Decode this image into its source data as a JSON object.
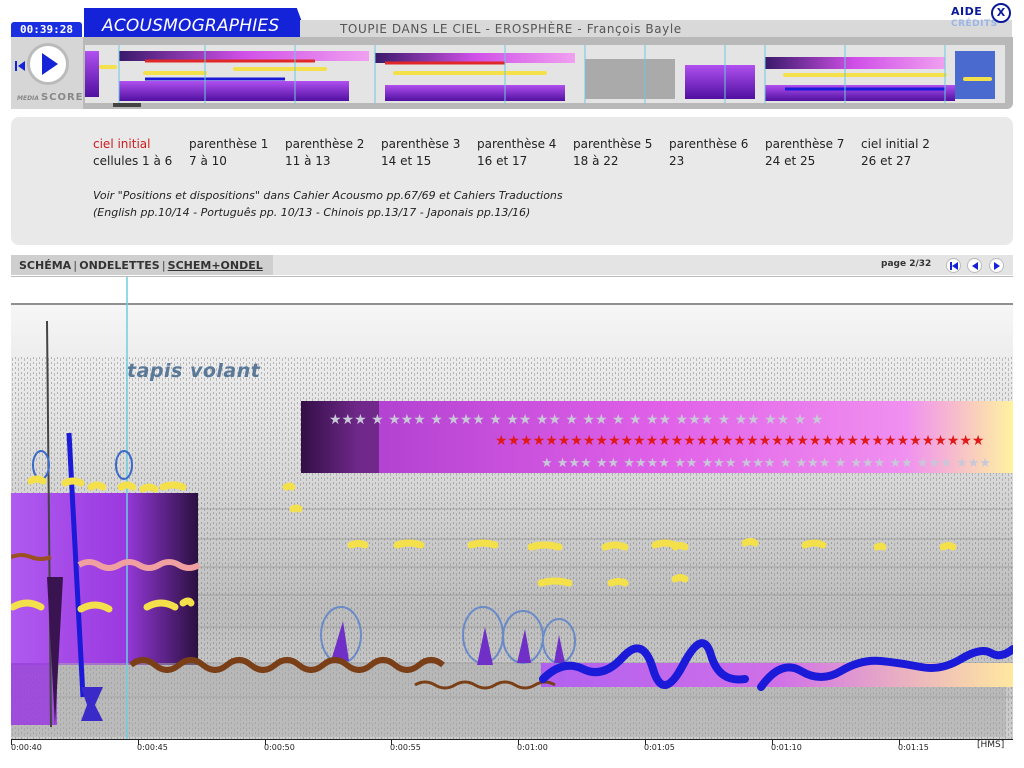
{
  "header": {
    "timer": "00:39:28",
    "app_title": "ACOUSMOGRAPHIES",
    "work_title": "TOUPIE DANS LE CIEL - EROSPHÈRE - François Bayle",
    "aide": "AIDE",
    "credits": "CRÉDITS",
    "close": "X"
  },
  "player": {
    "score_logo_small": "MEDIA",
    "score_logo": "SCORE"
  },
  "sections": [
    {
      "name": "ciel initial",
      "cells": "cellules 1 à 6",
      "active": true
    },
    {
      "name": "parenthèse 1",
      "cells": "7 à 10",
      "active": false
    },
    {
      "name": "parenthèse 2",
      "cells": "11 à 13",
      "active": false
    },
    {
      "name": "parenthèse 3",
      "cells": "14 et 15",
      "active": false
    },
    {
      "name": "parenthèse 4",
      "cells": "16 et 17",
      "active": false
    },
    {
      "name": "parenthèse 5",
      "cells": "18 à 22",
      "active": false
    },
    {
      "name": "parenthèse 6",
      "cells": "23",
      "active": false
    },
    {
      "name": "parenthèse 7",
      "cells": "24 et 25",
      "active": false
    },
    {
      "name": "ciel initial 2",
      "cells": "26 et 27",
      "active": false
    }
  ],
  "notes": {
    "line1": "Voir \"Positions et dispositions\" dans Cahier Acousmo pp.67/69  et Cahiers Traductions",
    "line2": "(English pp.10/14 -  Português pp. 10/13  - Chinois pp.13/17 - Japonais pp.13/16)"
  },
  "view": {
    "tabs": [
      "SCHÉMA",
      "ONDELETTES",
      "SCHEM+ONDEL"
    ],
    "page": "page 2/32",
    "annotation": "tapis volant"
  },
  "timeline": {
    "labels": [
      "0:00:40",
      "0:00:45",
      "0:00:50",
      "0:00:55",
      "0:01:00",
      "0:01:05",
      "0:01:10",
      "0:01:15"
    ],
    "unit": "[HMS]"
  },
  "colors": {
    "accent_blue": "#1422d8",
    "active_red": "#cc1b1b",
    "violet": "#a040e8",
    "magenta": "#e060e0",
    "gold": "#f4e04a",
    "brown": "#7a3f16",
    "stroke_blue": "#1a1ad8"
  },
  "icons": [
    "play-icon",
    "rewind-icon",
    "close-icon",
    "first-page-icon",
    "prev-page-icon",
    "next-page-icon"
  ]
}
